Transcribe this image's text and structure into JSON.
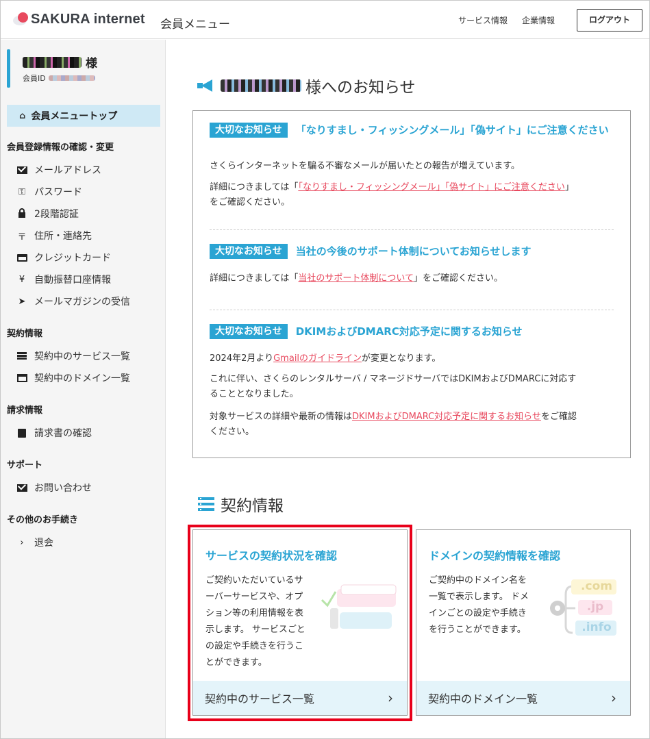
{
  "header": {
    "logo_text": "SAKURA internet",
    "title": "会員メニュー",
    "links": [
      "サービス情報",
      "企業情報"
    ],
    "logout_label": "ログアウト"
  },
  "sidebar": {
    "user_suffix": "様",
    "member_id_label": "会員ID",
    "top_item": "会員メニュートップ",
    "sections": [
      {
        "title": "会員登録情報の確認・変更",
        "items": [
          {
            "icon": "mail-icon",
            "label": "メールアドレス"
          },
          {
            "icon": "key-icon",
            "label": "パスワード"
          },
          {
            "icon": "lock-icon",
            "label": "2段階認証"
          },
          {
            "icon": "postal-icon",
            "label": "住所・連絡先"
          },
          {
            "icon": "credit-card-icon",
            "label": "クレジットカード"
          },
          {
            "icon": "yen-icon",
            "label": "自動振替口座情報"
          },
          {
            "icon": "paper-plane-icon",
            "label": "メールマガジンの受信"
          }
        ]
      },
      {
        "title": "契約情報",
        "items": [
          {
            "icon": "server-icon",
            "label": "契約中のサービス一覧"
          },
          {
            "icon": "window-icon",
            "label": "契約中のドメイン一覧"
          }
        ]
      },
      {
        "title": "請求情報",
        "items": [
          {
            "icon": "invoice-icon",
            "label": "請求書の確認"
          }
        ]
      },
      {
        "title": "サポート",
        "items": [
          {
            "icon": "mail-icon",
            "label": "お問い合わせ"
          }
        ]
      },
      {
        "title": "その他のお手続き",
        "items": [
          {
            "icon": "chevron-right-icon",
            "label": "退会"
          }
        ]
      }
    ]
  },
  "notices": {
    "title_suffix": "様へのお知らせ",
    "badge": "大切なお知らせ",
    "items": [
      {
        "title": "「なりすまし・フィッシングメール」「偽サイト」にご注意ください",
        "p1": "さくらインターネットを騙る不審なメールが届いたとの報告が増えています。",
        "p2_pre": "詳細につきましては「",
        "p2_link": "「なりすまし・フィッシングメール」「偽サイト」にご注意ください",
        "p2_post": "」",
        "p2_tail": "をご確認ください。"
      },
      {
        "title": "当社の今後のサポート体制についてお知らせします",
        "p1_pre": "詳細につきましては「",
        "p1_link": "当社のサポート体制について",
        "p1_post": "」をご確認ください。"
      },
      {
        "title": "DKIMおよびDMARC対応予定に関するお知らせ",
        "p1_pre": "2024年2月より",
        "p1_link": "Gmailのガイドライン",
        "p1_post": "が変更となります。",
        "p2a": "これに伴い、さくらのレンタルサーバ / マネージドサーバではDKIMおよびDMARCに対応す",
        "p2b": "ることとなりました。",
        "p3_pre": "対象サービスの詳細や最新の情報は",
        "p3_link": "DKIMおよびDMARC対応予定に関するお知らせ",
        "p3_post": "をご確認",
        "p3_tail": "ください。"
      }
    ]
  },
  "contract": {
    "title": "契約情報",
    "cards": [
      {
        "title": "サービスの契約状況を確認",
        "desc_lines": [
          "ご契約いただいているサ",
          "ーバーサービスや、オプ",
          "ション等の利用情報を表",
          "示します。 サービスごと",
          "の設定や手続きを行うこ",
          "とができます。"
        ],
        "footer": "契約中のサービス一覧"
      },
      {
        "title": "ドメインの契約情報を確認",
        "desc_lines": [
          "ご契約中のドメイン名を",
          "一覧で表示します。 ドメ",
          "インごとの設定や手続き",
          "を行うことができます。"
        ],
        "footer": "契約中のドメイン一覧",
        "domains": [
          ".com",
          ".jp",
          ".info"
        ]
      }
    ]
  },
  "colors": {
    "accent": "#2aa4d3",
    "link": "#e8495e",
    "highlight": "#e8001a"
  }
}
